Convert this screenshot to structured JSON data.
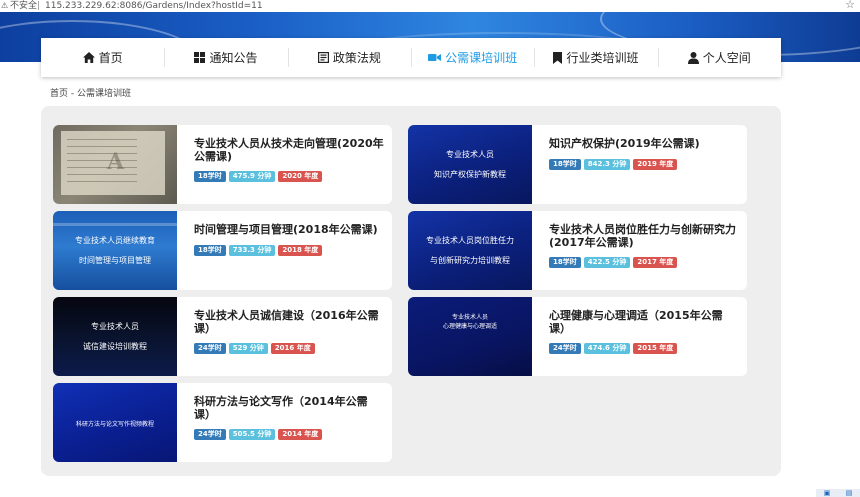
{
  "browser": {
    "security": "不安全",
    "url": "115.233.229.62:8086/Gardens/Index?hostId=11"
  },
  "nav": {
    "items": [
      {
        "label": "首页",
        "icon": "home-icon",
        "active": false
      },
      {
        "label": "通知公告",
        "icon": "grid-icon",
        "active": false
      },
      {
        "label": "政策法规",
        "icon": "document-icon",
        "active": false
      },
      {
        "label": "公需课培训班",
        "icon": "video-camera-icon",
        "active": true
      },
      {
        "label": "行业类培训班",
        "icon": "bookmark-icon",
        "active": false
      },
      {
        "label": "个人空间",
        "icon": "user-icon",
        "active": false
      }
    ]
  },
  "breadcrumb": "首页 - 公需课培训班",
  "courses": [
    {
      "title": "专业技术人员从技术走向管理(2020年公需课)",
      "hours": "18学时",
      "minutes": "475.9 分钟",
      "year": "2020 年度",
      "thumb": {
        "style": "gray",
        "line1": "",
        "line2": ""
      }
    },
    {
      "title": "知识产权保护(2019年公需课)",
      "hours": "18学时",
      "minutes": "842.3 分钟",
      "year": "2019 年度",
      "thumb": {
        "style": "darkblue",
        "line1": "专业技术人员",
        "line2": "知识产权保护新教程"
      }
    },
    {
      "title": "时间管理与项目管理(2018年公需课)",
      "hours": "18学时",
      "minutes": "733.3 分钟",
      "year": "2018 年度",
      "thumb": {
        "style": "blue",
        "line1": "专业技术人员继续教育",
        "line2": "时间管理与项目管理"
      }
    },
    {
      "title": "专业技术人员岗位胜任力与创新研究力(2017年公需课)",
      "hours": "18学时",
      "minutes": "422.5 分钟",
      "year": "2017 年度",
      "thumb": {
        "style": "darkblue",
        "line1": "专业技术人员岗位胜任力",
        "line2": "与创新研究力培训教程"
      }
    },
    {
      "title": "专业技术人员诚信建设（2016年公需课）",
      "hours": "24学时",
      "minutes": "529 分钟",
      "year": "2016 年度",
      "thumb": {
        "style": "black",
        "line1": "专业技术人员",
        "line2": "诚信建设培训教程"
      }
    },
    {
      "title": "心理健康与心理调适（2015年公需课）",
      "hours": "24学时",
      "minutes": "474.6 分钟",
      "year": "2015 年度",
      "thumb": {
        "style": "navy",
        "line1": "专业技术人员",
        "line2": "心理健康与心理调适"
      }
    },
    {
      "title": "科研方法与论文写作（2014年公需课）",
      "hours": "24学时",
      "minutes": "505.5 分钟",
      "year": "2014 年度",
      "thumb": {
        "style": "deepblue",
        "line1": "科研方法与论文写作视频教程",
        "line2": ""
      }
    }
  ],
  "colors": {
    "active_nav": "#1f9be4",
    "badge_hours": "#337ab7",
    "badge_minutes": "#5bc0de",
    "badge_year": "#d9534f"
  }
}
